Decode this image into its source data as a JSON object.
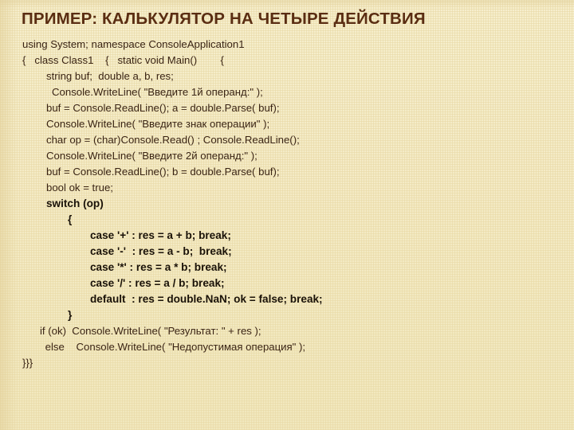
{
  "slide": {
    "title": "Пример: калькулятор на четыре действия",
    "background_color": "#f4ebc6",
    "title_color": "#5a2d12",
    "code_color": "#3a2414",
    "code_bold_color": "#1a1208",
    "code_language": "C#",
    "code_lines": [
      {
        "indent": 28,
        "bold": false,
        "text": "using System; namespace ConsoleApplication1"
      },
      {
        "indent": 28,
        "bold": false,
        "text": "{   class Class1    {   static void Main()        {"
      },
      {
        "indent": 58,
        "bold": false,
        "text": "string buf;  double a, b, res;"
      },
      {
        "indent": 65,
        "bold": false,
        "text": "Console.WriteLine( \"Введите 1й операнд:\" );"
      },
      {
        "indent": 58,
        "bold": false,
        "text": "buf = Console.ReadLine(); a = double.Parse( buf);"
      },
      {
        "indent": 58,
        "bold": false,
        "text": "Console.WriteLine( \"Введите знак операции\" );"
      },
      {
        "indent": 58,
        "bold": false,
        "text": "char op = (char)Console.Read() ; Console.ReadLine();"
      },
      {
        "indent": 58,
        "bold": false,
        "text": "Console.WriteLine( \"Введите 2й операнд:\" );"
      },
      {
        "indent": 58,
        "bold": false,
        "text": "buf = Console.ReadLine(); b = double.Parse( buf);"
      },
      {
        "indent": 58,
        "bold": false,
        "text": "bool ok = true;"
      },
      {
        "indent": 58,
        "bold": true,
        "text": "switch (op)"
      },
      {
        "indent": 85,
        "bold": true,
        "text": "{"
      },
      {
        "indent": 113,
        "bold": true,
        "text": "case '+' : res = a + b; break;"
      },
      {
        "indent": 113,
        "bold": true,
        "text": "case '-'  : res = a - b;  break;"
      },
      {
        "indent": 113,
        "bold": true,
        "text": "case '*' : res = a * b; break;"
      },
      {
        "indent": 113,
        "bold": true,
        "text": "case '/' : res = a / b; break;"
      },
      {
        "indent": 113,
        "bold": true,
        "text": "default  : res = double.NaN; ok = false; break;"
      },
      {
        "indent": 85,
        "bold": true,
        "text": "}"
      },
      {
        "indent": 50,
        "bold": false,
        "text": "if (ok)  Console.WriteLine( \"Результат: \" + res );"
      },
      {
        "indent": 53,
        "bold": false,
        "text": " else    Console.WriteLine( \"Недопустимая операция\" );"
      },
      {
        "indent": 28,
        "bold": false,
        "text": "}}}"
      }
    ]
  }
}
